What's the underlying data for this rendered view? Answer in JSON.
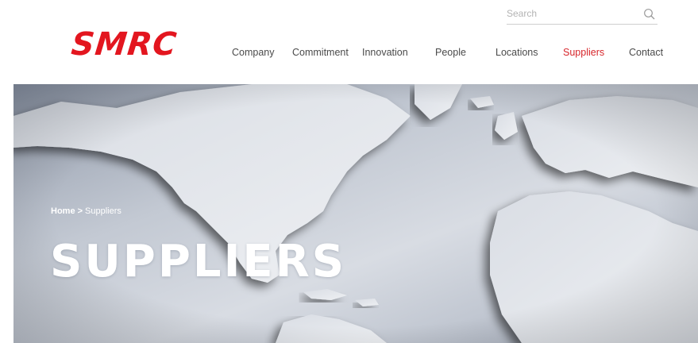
{
  "brand": {
    "logo_text": "SMRC",
    "accent_color": "#e3161f"
  },
  "search": {
    "placeholder": "Search",
    "icon": "search-icon"
  },
  "nav": {
    "items": [
      {
        "label": "Company",
        "active": false
      },
      {
        "label": "Commitment",
        "active": false
      },
      {
        "label": "Innovation",
        "active": false
      },
      {
        "label": "People",
        "active": false
      },
      {
        "label": "Locations",
        "active": false
      },
      {
        "label": "Suppliers",
        "active": true
      },
      {
        "label": "Contact",
        "active": false
      }
    ],
    "active_color": "#d7262b"
  },
  "hero": {
    "breadcrumb": {
      "home": "Home",
      "separator": ">",
      "current": "Suppliers"
    },
    "title": "SUPPLIERS",
    "background": "world-map-image"
  }
}
